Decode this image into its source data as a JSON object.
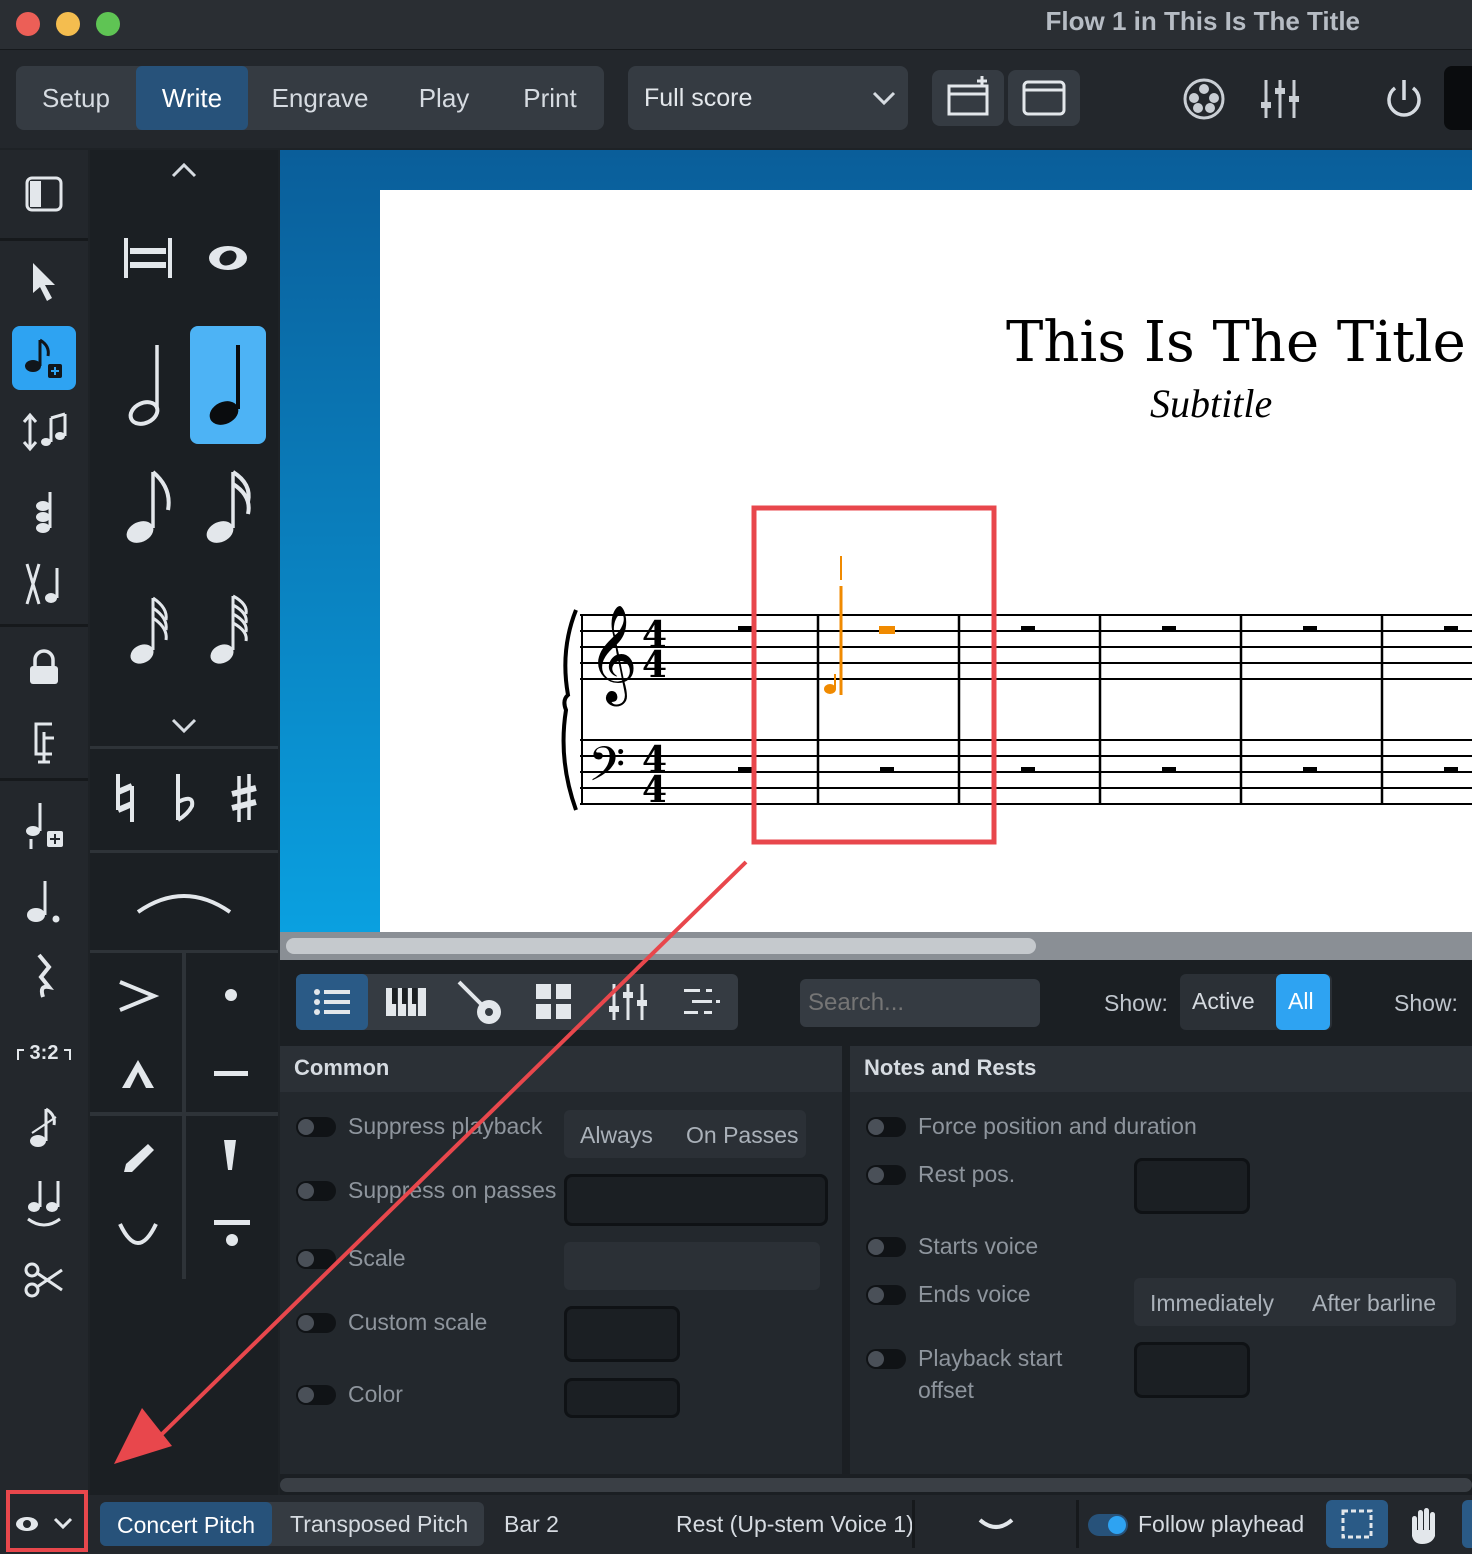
{
  "window": {
    "title": "Flow 1 in This Is The Title",
    "traffic_colors": [
      "#ec5f57",
      "#f4bd4f",
      "#5fc454"
    ]
  },
  "modes": [
    {
      "label": "Setup",
      "active": false
    },
    {
      "label": "Write",
      "active": true
    },
    {
      "label": "Engrave",
      "active": false
    },
    {
      "label": "Play",
      "active": false
    },
    {
      "label": "Print",
      "active": false
    }
  ],
  "layout_select": {
    "value": "Full score"
  },
  "score": {
    "title": "This Is The Title",
    "subtitle": "Subtitle",
    "highlight_color": "#e8474c",
    "selection_color": "#f08a00"
  },
  "lower_panel": {
    "search_placeholder": "Search...",
    "show_label": "Show:",
    "show_options": [
      "Active",
      "All"
    ],
    "show_active": "All",
    "show_label_2": "Show:",
    "common": {
      "header": "Common",
      "props": [
        "Suppress playback",
        "Suppress on passes",
        "Scale",
        "Custom scale",
        "Color"
      ],
      "playback_options": [
        "Always",
        "On Passes"
      ]
    },
    "notes_rests": {
      "header": "Notes and Rests",
      "props": [
        "Force position and duration",
        "Rest pos.",
        "Starts voice",
        "Ends voice",
        "Playback start",
        "offset"
      ],
      "ends_voice_options": [
        "Immediately",
        "After barline"
      ]
    }
  },
  "status_bar": {
    "pitch_options": [
      "Concert Pitch",
      "Transposed Pitch"
    ],
    "pitch_active": "Concert Pitch",
    "bar": "Bar 2",
    "selection": "Rest (Up-stem Voice 1)",
    "follow_playhead": "Follow playhead",
    "annotation_color": "#e8474c"
  }
}
